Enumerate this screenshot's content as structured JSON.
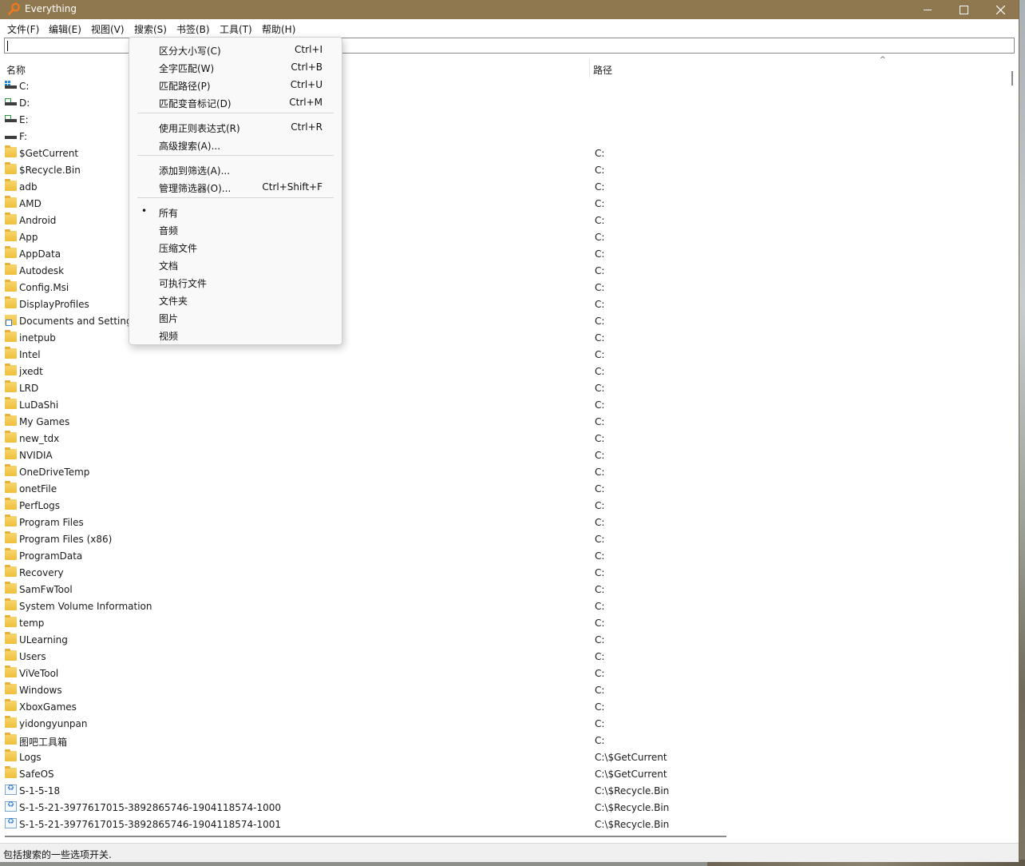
{
  "window": {
    "title": "Everything",
    "min_icon": "minimize-icon",
    "max_icon": "maximize-icon",
    "close_icon": "close-icon"
  },
  "menubar": {
    "file": "文件(F)",
    "edit": "编辑(E)",
    "view": "视图(V)",
    "search": "搜索(S)",
    "bookmarks": "书签(B)",
    "tools": "工具(T)",
    "help": "帮助(H)"
  },
  "search": {
    "value": ""
  },
  "columns": {
    "name": "名称",
    "path": "路径"
  },
  "rows": [
    {
      "name": "C:",
      "path": "",
      "icon": "system-drive"
    },
    {
      "name": "D:",
      "path": "",
      "icon": "drive"
    },
    {
      "name": "E:",
      "path": "",
      "icon": "drive"
    },
    {
      "name": "F:",
      "path": "",
      "icon": "plain-drive"
    },
    {
      "name": "$GetCurrent",
      "path": "C:",
      "icon": "folder"
    },
    {
      "name": "$Recycle.Bin",
      "path": "C:",
      "icon": "folder"
    },
    {
      "name": "adb",
      "path": "C:",
      "icon": "folder"
    },
    {
      "name": "AMD",
      "path": "C:",
      "icon": "folder"
    },
    {
      "name": "Android",
      "path": "C:",
      "icon": "folder"
    },
    {
      "name": "App",
      "path": "C:",
      "icon": "folder"
    },
    {
      "name": "AppData",
      "path": "C:",
      "icon": "folder"
    },
    {
      "name": "Autodesk",
      "path": "C:",
      "icon": "folder"
    },
    {
      "name": "Config.Msi",
      "path": "C:",
      "icon": "folder"
    },
    {
      "name": "DisplayProfiles",
      "path": "C:",
      "icon": "folder"
    },
    {
      "name": "Documents and Settings",
      "path": "C:",
      "icon": "link-folder"
    },
    {
      "name": "inetpub",
      "path": "C:",
      "icon": "folder"
    },
    {
      "name": "Intel",
      "path": "C:",
      "icon": "folder"
    },
    {
      "name": "jxedt",
      "path": "C:",
      "icon": "folder"
    },
    {
      "name": "LRD",
      "path": "C:",
      "icon": "folder"
    },
    {
      "name": "LuDaShi",
      "path": "C:",
      "icon": "folder"
    },
    {
      "name": "My Games",
      "path": "C:",
      "icon": "folder"
    },
    {
      "name": "new_tdx",
      "path": "C:",
      "icon": "folder"
    },
    {
      "name": "NVIDIA",
      "path": "C:",
      "icon": "folder"
    },
    {
      "name": "OneDriveTemp",
      "path": "C:",
      "icon": "folder"
    },
    {
      "name": "onetFile",
      "path": "C:",
      "icon": "folder"
    },
    {
      "name": "PerfLogs",
      "path": "C:",
      "icon": "folder"
    },
    {
      "name": "Program Files",
      "path": "C:",
      "icon": "folder"
    },
    {
      "name": "Program Files (x86)",
      "path": "C:",
      "icon": "folder"
    },
    {
      "name": "ProgramData",
      "path": "C:",
      "icon": "folder"
    },
    {
      "name": "Recovery",
      "path": "C:",
      "icon": "folder"
    },
    {
      "name": "SamFwTool",
      "path": "C:",
      "icon": "folder"
    },
    {
      "name": "System Volume Information",
      "path": "C:",
      "icon": "folder"
    },
    {
      "name": "temp",
      "path": "C:",
      "icon": "folder"
    },
    {
      "name": "ULearning",
      "path": "C:",
      "icon": "folder"
    },
    {
      "name": "Users",
      "path": "C:",
      "icon": "folder"
    },
    {
      "name": "ViVeTool",
      "path": "C:",
      "icon": "folder"
    },
    {
      "name": "Windows",
      "path": "C:",
      "icon": "folder"
    },
    {
      "name": "XboxGames",
      "path": "C:",
      "icon": "folder"
    },
    {
      "name": "yidongyunpan",
      "path": "C:",
      "icon": "folder"
    },
    {
      "name": "图吧工具箱",
      "path": "C:",
      "icon": "folder"
    },
    {
      "name": "Logs",
      "path": "C:\\$GetCurrent",
      "icon": "folder"
    },
    {
      "name": "SafeOS",
      "path": "C:\\$GetCurrent",
      "icon": "folder"
    },
    {
      "name": "S-1-5-18",
      "path": "C:\\$Recycle.Bin",
      "icon": "recycle"
    },
    {
      "name": "S-1-5-21-3977617015-3892865746-1904118574-1000",
      "path": "C:\\$Recycle.Bin",
      "icon": "recycle"
    },
    {
      "name": "S-1-5-21-3977617015-3892865746-1904118574-1001",
      "path": "C:\\$Recycle.Bin",
      "icon": "recycle"
    }
  ],
  "search_menu": {
    "items": [
      {
        "label": "区分大小写(C)",
        "shortcut": "Ctrl+I"
      },
      {
        "label": "全字匹配(W)",
        "shortcut": "Ctrl+B"
      },
      {
        "label": "匹配路径(P)",
        "shortcut": "Ctrl+U"
      },
      {
        "label": "匹配变音标记(D)",
        "shortcut": "Ctrl+M"
      },
      {
        "label": "使用正则表达式(R)",
        "shortcut": "Ctrl+R"
      },
      {
        "label": "高级搜索(A)...",
        "shortcut": ""
      },
      {
        "label": "添加到筛选(A)...",
        "shortcut": ""
      },
      {
        "label": "管理筛选器(O)...",
        "shortcut": "Ctrl+Shift+F"
      },
      {
        "label": "所有",
        "shortcut": "",
        "checked": true
      },
      {
        "label": "音频",
        "shortcut": ""
      },
      {
        "label": "压缩文件",
        "shortcut": ""
      },
      {
        "label": "文档",
        "shortcut": ""
      },
      {
        "label": "可执行文件",
        "shortcut": ""
      },
      {
        "label": "文件夹",
        "shortcut": ""
      },
      {
        "label": "图片",
        "shortcut": ""
      },
      {
        "label": "视频",
        "shortcut": ""
      }
    ],
    "check_mark": "•"
  },
  "status": {
    "text": "包括搜索的一些选项开关."
  },
  "colors": {
    "titlebar": "#8f784f",
    "menu_bg": "#f9f9f9",
    "folder": "#f0bf3c"
  }
}
